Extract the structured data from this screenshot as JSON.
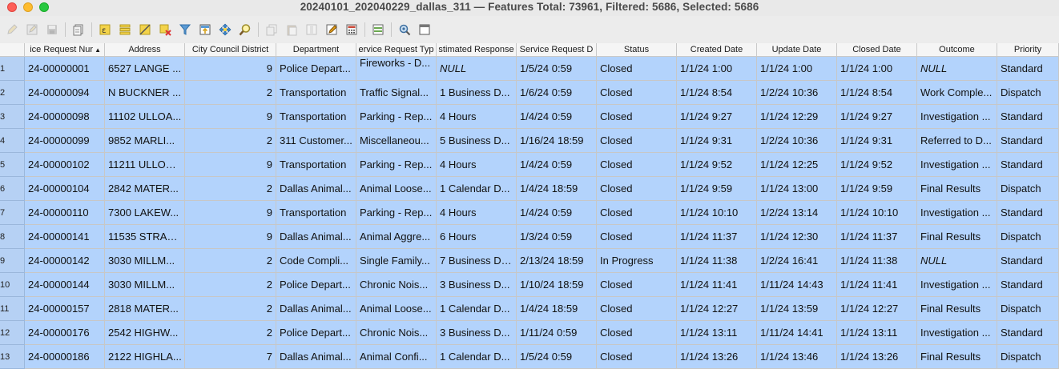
{
  "window": {
    "title": "20240101_202040229_dallas_311 — Features Total: 73961, Filtered: 5686, Selected: 5686"
  },
  "toolbar": {
    "buttons": [
      {
        "name": "toggle-editing-icon",
        "enabled": false
      },
      {
        "name": "multi-edit-icon",
        "enabled": false
      },
      {
        "name": "save-edits-icon",
        "enabled": false
      },
      {
        "name": "reload-table-icon",
        "enabled": true
      },
      {
        "name": "add-feature-icon",
        "enabled": true
      },
      {
        "name": "delete-selected-icon",
        "enabled": true
      },
      {
        "name": "select-by-expression-icon",
        "enabled": true
      },
      {
        "name": "select-all-icon",
        "enabled": true
      },
      {
        "name": "invert-selection-icon",
        "enabled": true
      },
      {
        "name": "deselect-all-icon",
        "enabled": true
      },
      {
        "name": "filter-select-features-icon",
        "enabled": true
      },
      {
        "name": "move-selection-top-icon",
        "enabled": true
      },
      {
        "name": "pan-to-selected-icon",
        "enabled": true
      },
      {
        "name": "zoom-to-selected-icon",
        "enabled": true
      },
      {
        "name": "copy-selected-icon",
        "enabled": false
      },
      {
        "name": "paste-features-icon",
        "enabled": false
      },
      {
        "name": "delete-field-icon",
        "enabled": false
      },
      {
        "name": "new-field-icon",
        "enabled": true
      },
      {
        "name": "field-calculator-icon",
        "enabled": true
      },
      {
        "name": "conditional-formatting-icon",
        "enabled": true
      },
      {
        "name": "actions-icon",
        "enabled": true
      },
      {
        "name": "dock-table-icon",
        "enabled": true
      }
    ]
  },
  "table": {
    "columns": [
      {
        "label": "ice Request Nur",
        "sorted": true
      },
      {
        "label": "Address"
      },
      {
        "label": "City Council District"
      },
      {
        "label": "Department"
      },
      {
        "label": "ervice Request Typ"
      },
      {
        "label": "stimated Response"
      },
      {
        "label": "Service Request D"
      },
      {
        "label": "Status"
      },
      {
        "label": "Created Date"
      },
      {
        "label": "Update Date"
      },
      {
        "label": "Closed Date"
      },
      {
        "label": "Outcome"
      },
      {
        "label": "Priority"
      }
    ],
    "rows": [
      {
        "n": "1",
        "cells": [
          "24-00000001",
          "6527 LANGE ...",
          "9",
          "Police Depart...",
          "Fireworks - D...",
          "NULL",
          "1/5/24 0:59",
          "Closed",
          "1/1/24 1:00",
          "1/1/24 1:00",
          "1/1/24 1:00",
          "NULL",
          "Standard"
        ]
      },
      {
        "n": "2",
        "cells": [
          "24-00000094",
          "N BUCKNER ...",
          "2",
          "Transportation",
          "Traffic Signal...",
          "1 Business D...",
          "1/6/24 0:59",
          "Closed",
          "1/1/24 8:54",
          "1/2/24 10:36",
          "1/1/24 8:54",
          "Work Comple...",
          "Dispatch"
        ]
      },
      {
        "n": "3",
        "cells": [
          "24-00000098",
          "11102 ULLOA...",
          "9",
          "Transportation",
          "Parking - Rep...",
          "4 Hours",
          "1/4/24 0:59",
          "Closed",
          "1/1/24 9:27",
          "1/1/24 12:29",
          "1/1/24 9:27",
          "Investigation ...",
          "Standard"
        ]
      },
      {
        "n": "4",
        "cells": [
          "24-00000099",
          "9852 MARLI...",
          "2",
          "311 Customer...",
          "Miscellaneou...",
          "5 Business D...",
          "1/16/24 18:59",
          "Closed",
          "1/1/24 9:31",
          "1/2/24 10:36",
          "1/1/24 9:31",
          "Referred to D...",
          "Standard"
        ]
      },
      {
        "n": "5",
        "cells": [
          "24-00000102",
          "11211 ULLOA ...",
          "9",
          "Transportation",
          "Parking - Rep...",
          "4 Hours",
          "1/4/24 0:59",
          "Closed",
          "1/1/24 9:52",
          "1/1/24 12:25",
          "1/1/24 9:52",
          "Investigation ...",
          "Standard"
        ]
      },
      {
        "n": "6",
        "cells": [
          "24-00000104",
          "2842 MATER...",
          "2",
          "Dallas Animal...",
          "Animal Loose...",
          "1 Calendar D...",
          "1/4/24 18:59",
          "Closed",
          "1/1/24 9:59",
          "1/1/24 13:00",
          "1/1/24 9:59",
          "Final Results",
          "Dispatch"
        ]
      },
      {
        "n": "7",
        "cells": [
          "24-00000110",
          "7300 LAKEW...",
          "9",
          "Transportation",
          "Parking - Rep...",
          "4 Hours",
          "1/4/24 0:59",
          "Closed",
          "1/1/24 10:10",
          "1/2/24 13:14",
          "1/1/24 10:10",
          "Investigation ...",
          "Standard"
        ]
      },
      {
        "n": "8",
        "cells": [
          "24-00000141",
          "11535 STRAN...",
          "9",
          "Dallas Animal...",
          "Animal Aggre...",
          "6 Hours",
          "1/3/24 0:59",
          "Closed",
          "1/1/24 11:37",
          "1/1/24 12:30",
          "1/1/24 11:37",
          "Final Results",
          "Dispatch"
        ]
      },
      {
        "n": "9",
        "cells": [
          "24-00000142",
          "3030 MILLM...",
          "2",
          "Code Compli...",
          "Single Family...",
          "7 Business De...",
          "2/13/24 18:59",
          "In Progress",
          "1/1/24 11:38",
          "1/2/24 16:41",
          "1/1/24 11:38",
          "NULL",
          "Standard"
        ]
      },
      {
        "n": "10",
        "cells": [
          "24-00000144",
          "3030 MILLM...",
          "2",
          "Police Depart...",
          "Chronic Nois...",
          "3 Business D...",
          "1/10/24 18:59",
          "Closed",
          "1/1/24 11:41",
          "1/11/24 14:43",
          "1/1/24 11:41",
          "Investigation ...",
          "Standard"
        ]
      },
      {
        "n": "11",
        "cells": [
          "24-00000157",
          "2818 MATER...",
          "2",
          "Dallas Animal...",
          "Animal Loose...",
          "1 Calendar D...",
          "1/4/24 18:59",
          "Closed",
          "1/1/24 12:27",
          "1/1/24 13:59",
          "1/1/24 12:27",
          "Final Results",
          "Dispatch"
        ]
      },
      {
        "n": "12",
        "cells": [
          "24-00000176",
          "2542 HIGHW...",
          "2",
          "Police Depart...",
          "Chronic Nois...",
          "3 Business D...",
          "1/11/24 0:59",
          "Closed",
          "1/1/24 13:11",
          "1/11/24 14:41",
          "1/1/24 13:11",
          "Investigation ...",
          "Standard"
        ]
      },
      {
        "n": "13",
        "cells": [
          "24-00000186",
          "2122 HIGHLA...",
          "7",
          "Dallas Animal...",
          "Animal Confi...",
          "1 Calendar D...",
          "1/5/24 0:59",
          "Closed",
          "1/1/24 13:26",
          "1/1/24 13:46",
          "1/1/24 13:26",
          "Final Results",
          "Dispatch"
        ]
      }
    ]
  },
  "colors": {
    "selection": "#b3d3fc",
    "row_header_selected": "#b6d1f4"
  }
}
